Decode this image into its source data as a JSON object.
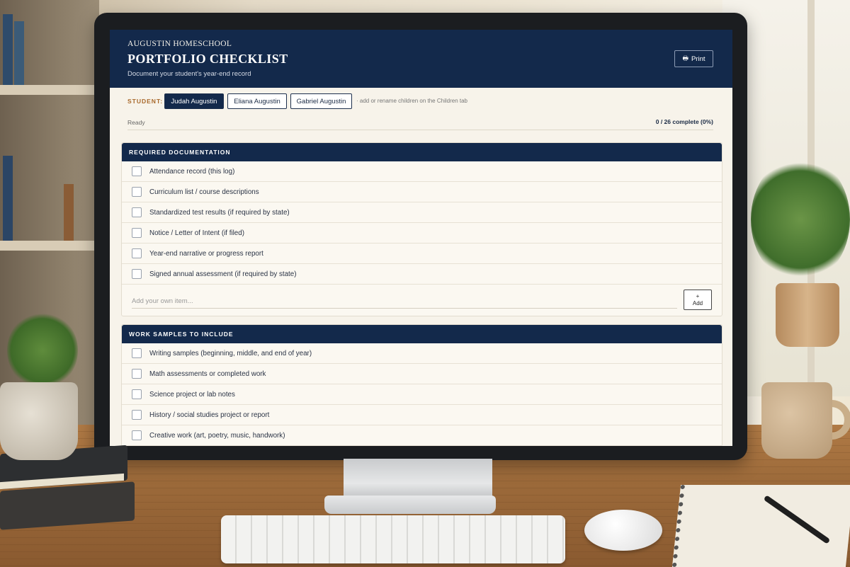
{
  "app": {
    "brand": "AUGUSTIN HOMESCHOOL",
    "title": "PORTFOLIO CHECKLIST",
    "subtitle": "Document your student's year-end record",
    "print_label": "Print",
    "print_icon": "printer-icon"
  },
  "students": {
    "label": "STUDENT:",
    "items": [
      {
        "name": "Judah Augustin",
        "active": true
      },
      {
        "name": "Eliana Augustin",
        "active": false
      },
      {
        "name": "Gabriel Augustin",
        "active": false
      }
    ],
    "hint": "· add or rename children on the Children tab"
  },
  "status": {
    "text": "Ready",
    "progress": "0 / 26 complete (0%)"
  },
  "sections": [
    {
      "title": "REQUIRED DOCUMENTATION",
      "items": [
        "Attendance record (this log)",
        "Curriculum list / course descriptions",
        "Standardized test results (if required by state)",
        "Notice / Letter of Intent (if filed)",
        "Year-end narrative or progress report",
        "Signed annual assessment (if required by state)"
      ],
      "add_placeholder": "Add your own item...",
      "add_label_top": "+",
      "add_label": "Add"
    },
    {
      "title": "WORK SAMPLES TO INCLUDE",
      "items": [
        "Writing samples (beginning, middle, and end of year)",
        "Math assessments or completed work",
        "Science project or lab notes",
        "History / social studies project or report",
        "Creative work (art, poetry, music, handwork)"
      ]
    }
  ],
  "colors": {
    "header_navy": "#13294b",
    "accent_orange": "#a8682a",
    "page_bg": "#f7f3ea"
  }
}
